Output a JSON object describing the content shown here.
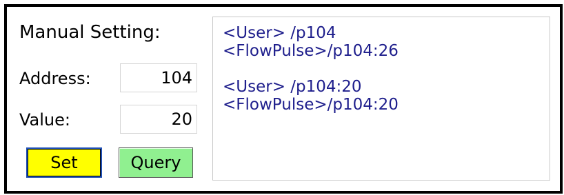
{
  "panel": {
    "title": "Manual Setting:"
  },
  "address": {
    "label": "Address:",
    "value": "104"
  },
  "value_field": {
    "label": "Value:",
    "value": "20"
  },
  "buttons": {
    "set_label": "Set",
    "query_label": "Query"
  },
  "log": {
    "lines": [
      "<User> /p104",
      "<FlowPulse>/p104:26",
      "",
      "<User> /p104:20",
      "<FlowPulse>/p104:20"
    ]
  },
  "colors": {
    "set_button_bg": "#ffff00",
    "set_button_border": "#1f4fb5",
    "query_button_bg": "#90f090",
    "log_text": "#1e1e8c",
    "frame_border": "#000000"
  }
}
